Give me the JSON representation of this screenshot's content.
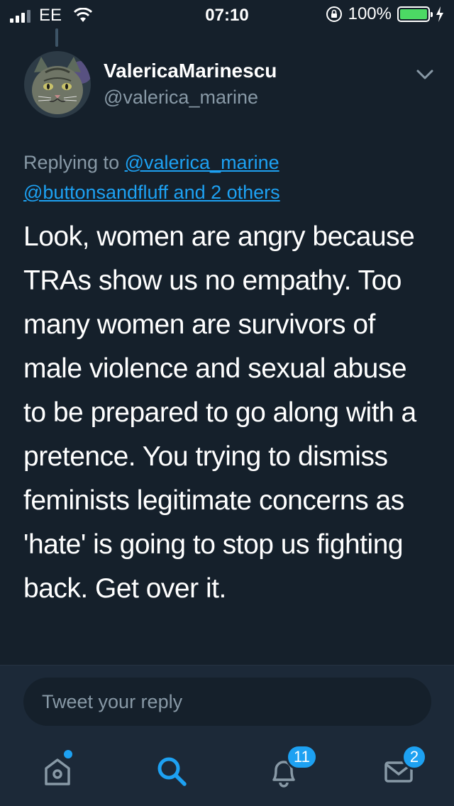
{
  "status_bar": {
    "carrier": "EE",
    "time": "07:10",
    "battery_percent": "100%",
    "battery_level": 1.0
  },
  "tweet": {
    "display_name": "ValericaMarinescu",
    "handle": "@valerica_marine",
    "replying_label": "Replying to",
    "replying_to_first": "@valerica_marine",
    "replying_to_rest": "@buttonsandfluff and 2 others",
    "text": "Look, women are angry because TRAs show us no empathy. Too many women are survivors of male violence and sexual abuse to be prepared to go along with a pretence. You trying to dismiss feminists legitimate concerns as 'hate' is going to stop us fighting back. Get over it."
  },
  "reply": {
    "placeholder": "Tweet your reply"
  },
  "tab_bar": {
    "items": [
      {
        "name": "home",
        "icon": "home-icon",
        "has_dot": true
      },
      {
        "name": "search",
        "icon": "search-icon",
        "active": true
      },
      {
        "name": "notifications",
        "icon": "bell-icon",
        "badge": "11"
      },
      {
        "name": "messages",
        "icon": "envelope-icon",
        "badge": "2"
      }
    ]
  },
  "colors": {
    "background": "#15202b",
    "accent": "#1da1f2",
    "secondary_text": "#8899a6",
    "battery": "#4cd964"
  }
}
